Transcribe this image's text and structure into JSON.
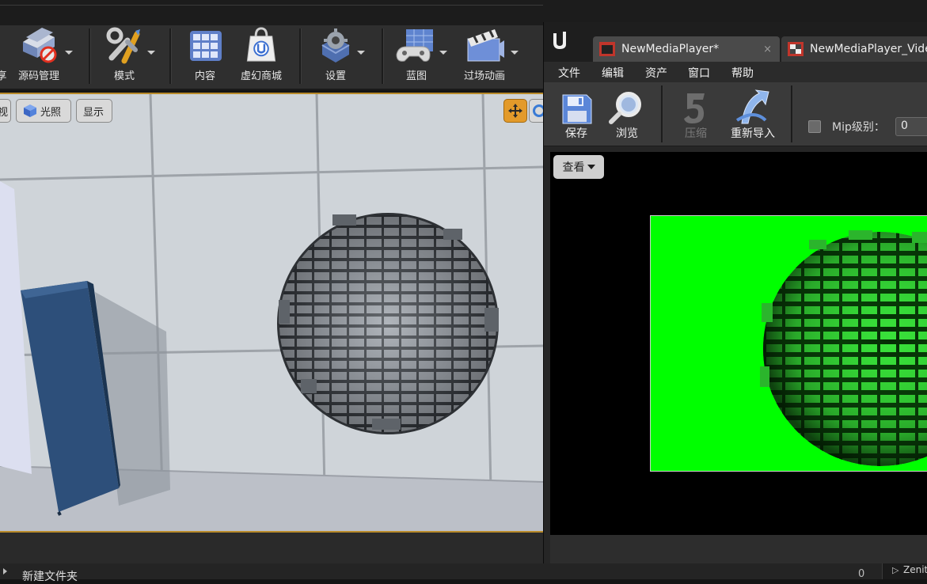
{
  "toolbar": {
    "partial_label": "享",
    "items": [
      {
        "label": "源码管理",
        "icon": "source-control-icon"
      },
      {
        "label": "模式",
        "icon": "modes-icon"
      },
      {
        "label": "内容",
        "icon": "content-icon"
      },
      {
        "label": "虚幻商城",
        "icon": "marketplace-icon"
      },
      {
        "label": "设置",
        "icon": "settings-icon"
      },
      {
        "label": "蓝图",
        "icon": "blueprints-icon"
      },
      {
        "label": "过场动画",
        "icon": "cinematics-icon"
      }
    ]
  },
  "viewport": {
    "partial_button": "视",
    "lit_button": "光照",
    "show_button": "显示"
  },
  "editor": {
    "tabs": [
      {
        "label": "NewMediaPlayer*",
        "close": "×"
      },
      {
        "label": "NewMediaPlayer_Vide"
      }
    ],
    "menu": [
      "文件",
      "编辑",
      "资产",
      "窗口",
      "帮助"
    ],
    "tools": [
      {
        "label": "保存",
        "icon": "save-icon",
        "enabled": true
      },
      {
        "label": "浏览",
        "icon": "browse-icon",
        "enabled": true
      },
      {
        "label": "压缩",
        "icon": "compress-icon",
        "enabled": false
      },
      {
        "label": "重新导入",
        "icon": "reimport-icon",
        "enabled": true
      }
    ],
    "mip_label": "Mip级别：",
    "mip_value": "0",
    "view_button": "查看"
  },
  "bottom": {
    "new_folder": "新建文件夹",
    "count": "0",
    "zenith_item": "Zenit"
  },
  "colors": {
    "accent": "#b88a2a",
    "preview_green": "#00ff00"
  }
}
